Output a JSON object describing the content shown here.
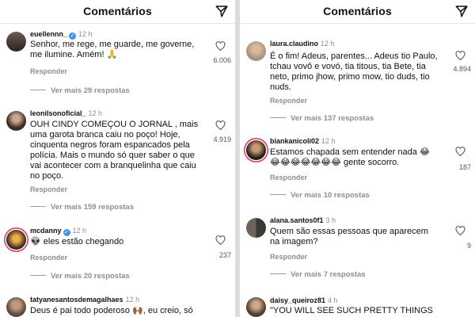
{
  "header": {
    "title": "Comentários"
  },
  "left_comments": [
    {
      "username": "euellennn_",
      "verified": true,
      "time": "12 h",
      "text": "Senhor, me rege, me guarde, me governe, me ilumine. Amém! 🙏",
      "reply": "Responder",
      "likes": "6.006",
      "more": "Ver mais 29 respostas"
    },
    {
      "username": "leonilsonoficial_",
      "verified": false,
      "time": "12 h",
      "text": "OUH CINDY COMEÇOU O JORNAL , mais uma garota branca caiu no poço! Hoje, cinquenta negros foram espancados pela polícia. Mais o mundo só quer saber o que vai acontecer com a branquelinha que caiu no poço.",
      "reply": "Responder",
      "likes": "4.919",
      "more": "Ver mais 159 respostas"
    },
    {
      "username": "mcdanny",
      "verified": true,
      "time": "12 h",
      "text": "👽 eles estão chegando",
      "reply": "Responder",
      "likes": "237",
      "more": "Ver mais 20 respostas"
    },
    {
      "username": "tatyanesantosdemagalhaes",
      "verified": false,
      "time": "12 h",
      "text": "Deus é pai todo poderoso 🙌🏾, eu creio, só",
      "reply": "",
      "likes": "",
      "more": ""
    }
  ],
  "right_comments": [
    {
      "username": "laura.claudino",
      "verified": false,
      "time": "12 h",
      "text": "É o fim! Adeus, parentes... Adeus tio Paulo, tchau vovô e vovó, tia titous, tia Bete, tia neto, primo jhow, primo mow, tio duds, tio nuds.",
      "reply": "Responder",
      "likes": "4.894",
      "more": "Ver mais 137 respostas"
    },
    {
      "username": "biankanicoli02",
      "verified": false,
      "time": "12 h",
      "text": "Estamos chapada sem entender nada 😂 😂😂😂😂😂😂😂 gente socorro.",
      "reply": "Responder",
      "likes": "187",
      "more": "Ver mais 10 respostas"
    },
    {
      "username": "alana.santos0f1",
      "verified": false,
      "time": "3 h",
      "text": "Quem são essas pessoas que aparecem na imagem?",
      "reply": "Responder",
      "likes": "9",
      "more": "Ver mais 7 respostas"
    },
    {
      "username": "daisy_queiroz81",
      "verified": false,
      "time": "4 h",
      "text": "\"YOU WILL SEE SUCH PRETTY THINGS",
      "reply": "",
      "likes": "",
      "more": ""
    }
  ],
  "icons": {
    "send": "send-icon",
    "heart": "heart-icon",
    "verified": "verified-badge-icon"
  },
  "colors": {
    "verified": "#3897f0",
    "muted": "#8e8e8e",
    "story_ring": "#e1306c"
  }
}
